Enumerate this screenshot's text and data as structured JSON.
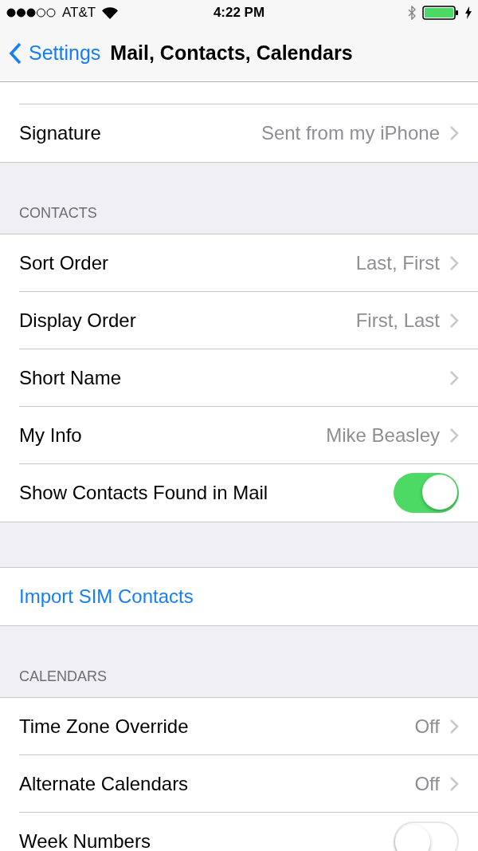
{
  "status_bar": {
    "carrier": "AT&T",
    "time": "4:22 PM"
  },
  "nav": {
    "back_label": "Settings",
    "title": "Mail, Contacts, Calendars"
  },
  "sections": [
    {
      "rows": [
        {
          "kind": "detail",
          "label": "Signature",
          "value": "Sent from my iPhone"
        }
      ]
    },
    {
      "header": "CONTACTS",
      "rows": [
        {
          "kind": "detail",
          "label": "Sort Order",
          "value": "Last, First"
        },
        {
          "kind": "detail",
          "label": "Display Order",
          "value": "First, Last"
        },
        {
          "kind": "detail",
          "label": "Short Name"
        },
        {
          "kind": "detail",
          "label": "My Info",
          "value": "Mike Beasley"
        },
        {
          "kind": "toggle",
          "label": "Show Contacts Found in Mail",
          "on": true
        }
      ]
    },
    {
      "rows": [
        {
          "kind": "action",
          "label": "Import SIM Contacts"
        }
      ]
    },
    {
      "header": "CALENDARS",
      "rows": [
        {
          "kind": "detail",
          "label": "Time Zone Override",
          "value": "Off"
        },
        {
          "kind": "detail",
          "label": "Alternate Calendars",
          "value": "Off"
        },
        {
          "kind": "toggle",
          "label": "Week Numbers",
          "on": false
        }
      ]
    }
  ]
}
